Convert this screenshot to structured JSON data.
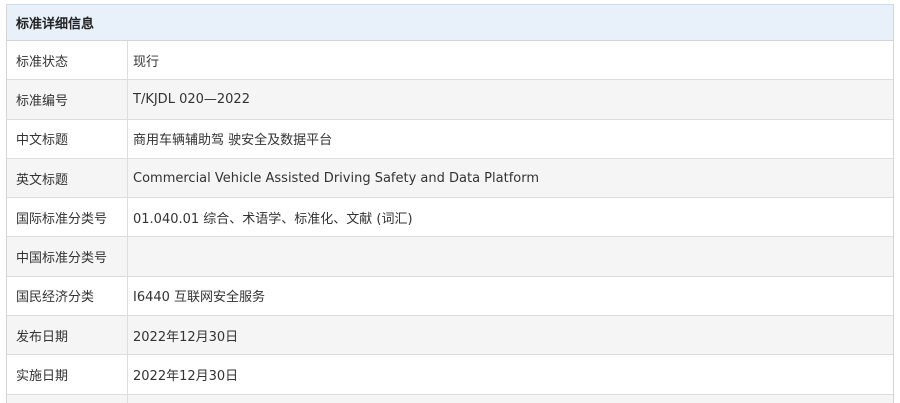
{
  "panel": {
    "title": "标准详细信息"
  },
  "rows": [
    {
      "label": "标准状态",
      "value": "现行"
    },
    {
      "label": "标准编号",
      "value": "T/KJDL 020—2022"
    },
    {
      "label": "中文标题",
      "value": "商用车辆辅助驾 驶安全及数据平台"
    },
    {
      "label": "英文标题",
      "value": "Commercial Vehicle Assisted Driving Safety and Data Platform"
    },
    {
      "label": "国际标准分类号",
      "value": "01.040.01 综合、术语学、标准化、文献 (词汇)"
    },
    {
      "label": "中国标准分类号",
      "value": ""
    },
    {
      "label": "国民经济分类",
      "value": "I6440 互联网安全服务"
    },
    {
      "label": "发布日期",
      "value": "2022年12月30日"
    },
    {
      "label": "实施日期",
      "value": "2022年12月30日"
    }
  ]
}
